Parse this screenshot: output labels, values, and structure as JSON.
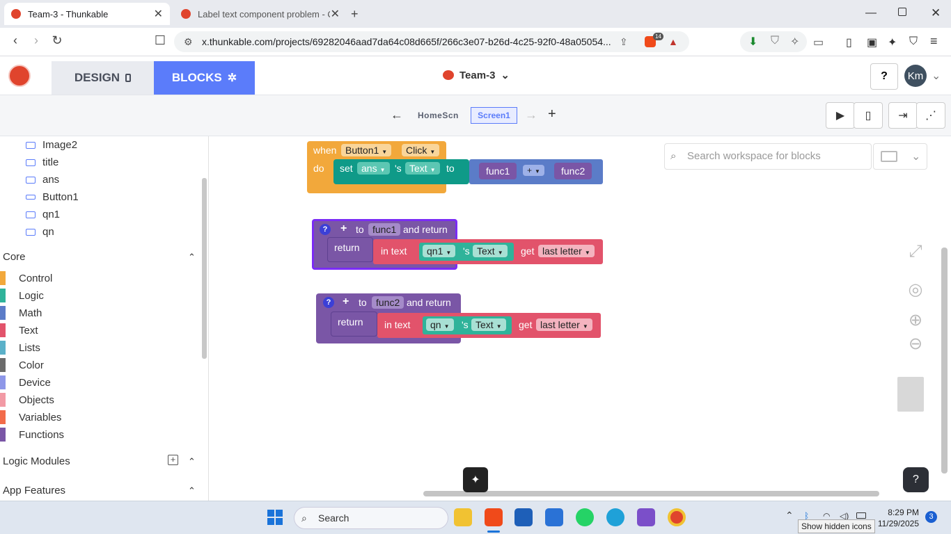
{
  "browser": {
    "tabs": [
      {
        "title": "Team-3 - Thunkable",
        "active": true
      },
      {
        "title": "Label text component problem - Que",
        "active": false
      }
    ],
    "url": "x.thunkable.com/projects/69282046aad7da64c08d665f/266c3e07-b26d-4c25-92f0-48a05054...",
    "brave_badge": "14"
  },
  "app": {
    "design_label": "DESIGN",
    "blocks_label": "BLOCKS",
    "project_name": "Team-3",
    "help_label": "?",
    "avatar_initials": "Km"
  },
  "screens": {
    "previous": "HomeScn",
    "current": "Screen1"
  },
  "components": [
    "Image2",
    "title",
    "ans",
    "Button1",
    "qn1",
    "qn"
  ],
  "sections": {
    "core": "Core",
    "logic_modules": "Logic Modules",
    "app_features": "App Features"
  },
  "categories": [
    {
      "label": "Control",
      "color": "#f2a83b"
    },
    {
      "label": "Logic",
      "color": "#2fb39a"
    },
    {
      "label": "Math",
      "color": "#5b7cc8"
    },
    {
      "label": "Text",
      "color": "#e2536b"
    },
    {
      "label": "Lists",
      "color": "#5bb1c9"
    },
    {
      "label": "Color",
      "color": "#6b6b6b"
    },
    {
      "label": "Device",
      "color": "#8e97e8"
    },
    {
      "label": "Objects",
      "color": "#f29aa5"
    },
    {
      "label": "Variables",
      "color": "#f26b4a"
    },
    {
      "label": "Functions",
      "color": "#7a56a6"
    }
  ],
  "workspace": {
    "search_placeholder": "Search workspace for blocks",
    "event_block": {
      "when": "when",
      "component": "Button1",
      "event": "Click",
      "do": "do",
      "set": "set",
      "target": "ans",
      "possessive": "'s",
      "property": "Text",
      "to": "to",
      "left": "func1",
      "op": "+",
      "right": "func2"
    },
    "func1_block": {
      "to": "to",
      "name": "func1",
      "and_return": "and return",
      "return": "return",
      "in_text": "in text",
      "component": "qn1",
      "possessive": "'s",
      "property": "Text",
      "get": "get",
      "which": "last letter"
    },
    "func2_block": {
      "to": "to",
      "name": "func2",
      "and_return": "and return",
      "return": "return",
      "in_text": "in text",
      "component": "qn",
      "possessive": "'s",
      "property": "Text",
      "get": "get",
      "which": "last letter"
    }
  },
  "taskbar": {
    "search_label": "Search",
    "time": "8:29 PM",
    "date": "11/29/2025",
    "notif_count": "3",
    "tooltip": "Show hidden icons"
  }
}
